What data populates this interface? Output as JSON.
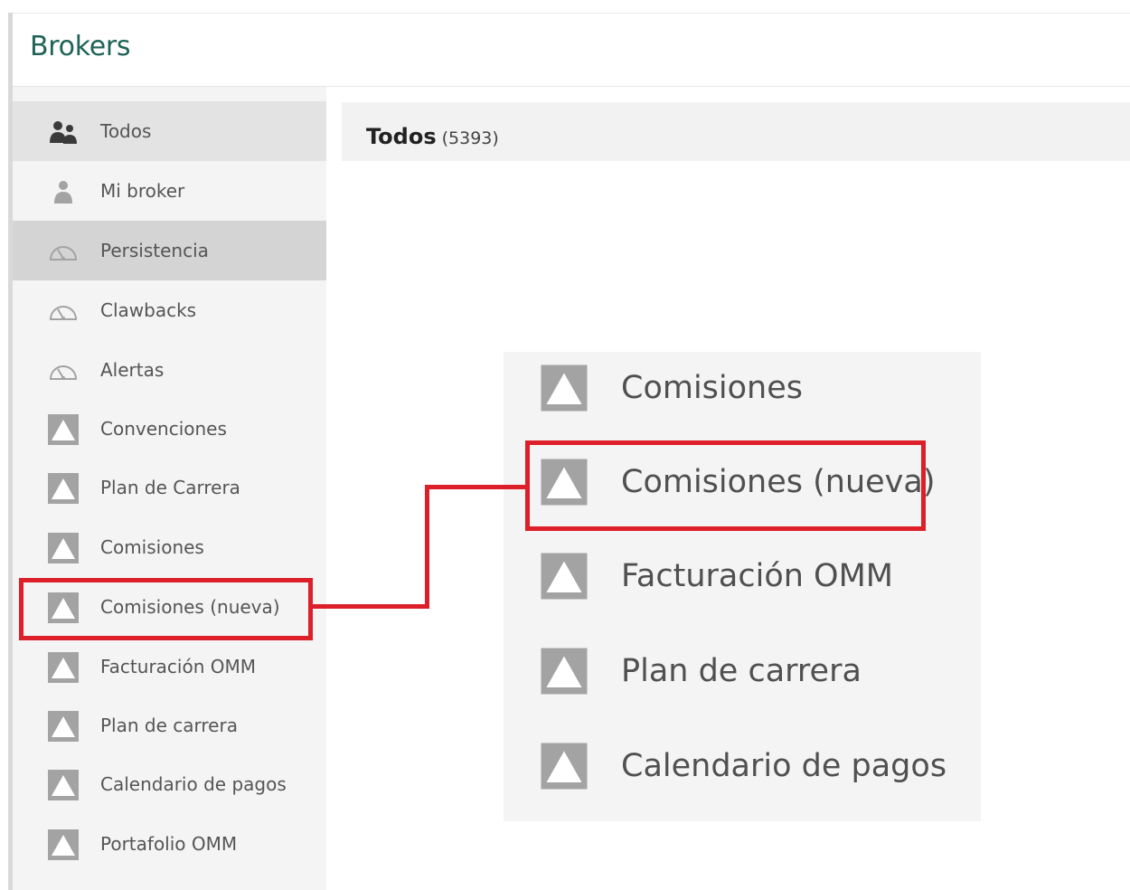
{
  "header": {
    "title": "Brokers"
  },
  "sidebar": {
    "items": [
      {
        "label": "Todos",
        "icon": "users-icon",
        "state": "active"
      },
      {
        "label": "Mi broker",
        "icon": "user-icon",
        "state": ""
      },
      {
        "label": "Persistencia",
        "icon": "gauge-icon",
        "state": "selected"
      },
      {
        "label": "Clawbacks",
        "icon": "gauge-icon",
        "state": ""
      },
      {
        "label": "Alertas",
        "icon": "gauge-icon",
        "state": ""
      },
      {
        "label": "Convenciones",
        "icon": "triangle-icon",
        "state": ""
      },
      {
        "label": "Plan de Carrera",
        "icon": "triangle-icon",
        "state": ""
      },
      {
        "label": "Comisiones",
        "icon": "triangle-icon",
        "state": ""
      },
      {
        "label": "Comisiones (nueva)",
        "icon": "triangle-icon",
        "state": "highlighted"
      },
      {
        "label": "Facturación OMM",
        "icon": "triangle-icon",
        "state": ""
      },
      {
        "label": "Plan de carrera",
        "icon": "triangle-icon",
        "state": ""
      },
      {
        "label": "Calendario de pagos",
        "icon": "triangle-icon",
        "state": ""
      },
      {
        "label": "Portafolio OMM",
        "icon": "triangle-icon",
        "state": ""
      }
    ]
  },
  "content": {
    "title": "Todos",
    "count": "(5393)"
  },
  "zoom": {
    "items": [
      {
        "label": "Comisiones",
        "icon": "triangle-icon"
      },
      {
        "label": "Comisiones (nueva)",
        "icon": "triangle-icon",
        "highlighted": true
      },
      {
        "label": "Facturación OMM",
        "icon": "triangle-icon"
      },
      {
        "label": "Plan de carrera",
        "icon": "triangle-icon"
      },
      {
        "label": "Calendario de pagos",
        "icon": "triangle-icon"
      }
    ]
  },
  "colors": {
    "title": "#1e6357",
    "highlight": "#dd1f29",
    "icon_gray": "#a3a3a3"
  }
}
